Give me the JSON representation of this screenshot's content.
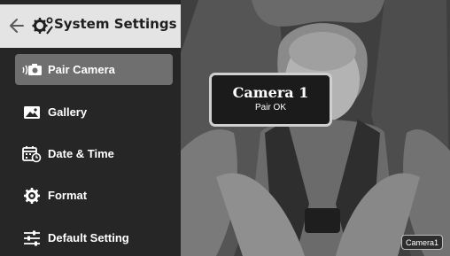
{
  "header": {
    "title": "System Settings"
  },
  "menu": {
    "items": [
      {
        "label": "Pair Camera",
        "icon": "pair-camera-icon",
        "active": true
      },
      {
        "label": "Gallery",
        "icon": "gallery-icon",
        "active": false
      },
      {
        "label": "Date & Time",
        "icon": "calendar-clock-icon",
        "active": false
      },
      {
        "label": "Format",
        "icon": "format-gear-icon",
        "active": false
      },
      {
        "label": "Default Setting",
        "icon": "sliders-icon",
        "active": false
      }
    ]
  },
  "popup": {
    "camera_name": "Camera 1",
    "status": "Pair OK"
  },
  "feed": {
    "badge": "Camera1"
  },
  "colors": {
    "panel_bg": "#262626",
    "header_bg": "#e4e4e4",
    "active_item_bg": "#6f6f6f",
    "text": "#ffffff"
  }
}
